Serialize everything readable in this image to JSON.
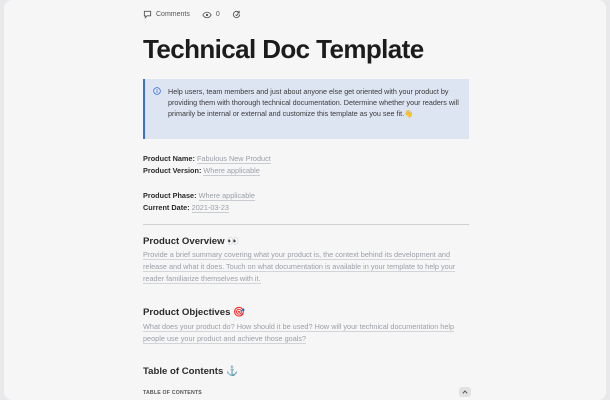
{
  "toolbar": {
    "comments_label": "Comments",
    "views_count": "0"
  },
  "title": "Technical Doc Template",
  "callout": {
    "text": "Help users, team members and just about anyone else get oriented with your product by providing them with thorough technical documentation. Determine whether your readers will primarily be internal or external and customize this template as you see fit.👋"
  },
  "fields": {
    "product_name_label": "Product Name:",
    "product_name_value": "Fabulous New Product",
    "product_version_label": "Product Version:",
    "product_version_value": "Where applicable",
    "product_phase_label": "Product Phase:",
    "product_phase_value": "Where applicable",
    "current_date_label": "Current Date:",
    "current_date_value": "2021-03-23"
  },
  "sections": {
    "overview_heading": "Product Overview 👀",
    "overview_text": "Provide a brief summary covering what your product is, the context behind its development and release and what it does. Touch on what documentation is available in your template to help your reader familiarize themselves with it.",
    "objectives_heading": "Product Objectives 🎯",
    "objectives_text": "What does your product do? How should it be used? How will your technical documentation help people use your product and achieve those goals?",
    "toc_heading": "Table of Contents ⚓",
    "toc_label": "TABLE OF CONTENTS"
  },
  "colors": {
    "accent": "#3a6fd8",
    "callout_bg": "#dde4f2"
  }
}
